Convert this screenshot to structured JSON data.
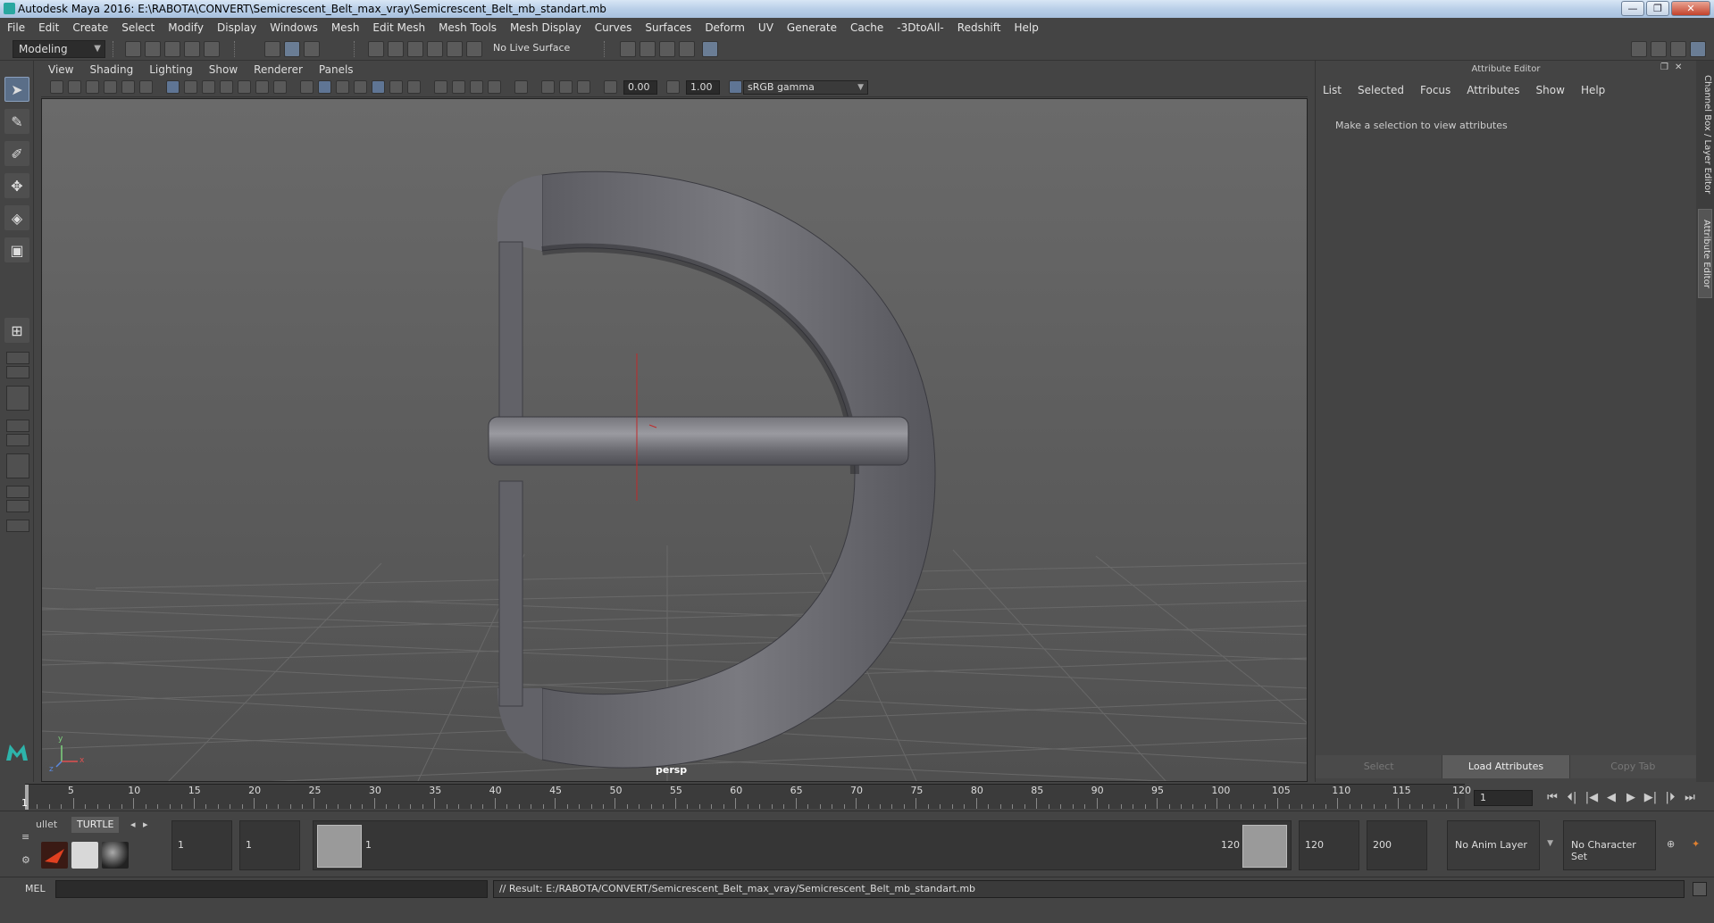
{
  "window": {
    "title": "Autodesk Maya 2016: E:\\RABOTA\\CONVERT\\Semicrescent_Belt_max_vray\\Semicrescent_Belt_mb_standart.mb",
    "buttons": {
      "minimize": "—",
      "maximize": "❐",
      "close": "✕"
    }
  },
  "menubar": [
    "File",
    "Edit",
    "Create",
    "Select",
    "Modify",
    "Display",
    "Windows",
    "Mesh",
    "Edit Mesh",
    "Mesh Tools",
    "Mesh Display",
    "Curves",
    "Surfaces",
    "Deform",
    "UV",
    "Generate",
    "Cache",
    "-3DtoAll-",
    "Redshift",
    "Help"
  ],
  "statusline": {
    "mode": "Modeling",
    "live_surface": "No Live Surface"
  },
  "viewport": {
    "menus": [
      "View",
      "Shading",
      "Lighting",
      "Show",
      "Renderer",
      "Panels"
    ],
    "exposure": "0.00",
    "gamma": "1.00",
    "color_space": "sRGB gamma",
    "camera_label": "persp",
    "axis_x": "x",
    "axis_y": "y",
    "axis_z": "z"
  },
  "attribute_editor": {
    "title": "Attribute Editor",
    "menus": [
      "List",
      "Selected",
      "Focus",
      "Attributes",
      "Show",
      "Help"
    ],
    "message": "Make a selection to view attributes",
    "buttons": [
      "Select",
      "Load Attributes",
      "Copy Tab"
    ]
  },
  "side_tabs": [
    "Channel Box / Layer Editor",
    "Attribute Editor"
  ],
  "timeslider": {
    "ticks": [
      1,
      5,
      10,
      15,
      20,
      25,
      30,
      35,
      40,
      45,
      50,
      55,
      60,
      65,
      70,
      75,
      80,
      85,
      90,
      95,
      100,
      105,
      110,
      115,
      120
    ],
    "current_frame": "1",
    "frame_field": "1",
    "start": 1,
    "end": 120
  },
  "playback": [
    "⏮",
    "⏴|",
    "|◀",
    "◀",
    "▶",
    "▶|",
    "|⏵",
    "⏭"
  ],
  "range": {
    "shelf_tabs": [
      "ullet",
      "TURTLE"
    ],
    "start_field": "1",
    "range_start_field": "1",
    "range_handle_start": "1",
    "range_handle_end": "120",
    "range_end_field": "120",
    "end_field": "200",
    "anim_layer": "No Anim Layer",
    "character_set": "No Character Set"
  },
  "cmdline": {
    "label": "MEL",
    "result": "// Result: E:/RABOTA/CONVERT/Semicrescent_Belt_max_vray/Semicrescent_Belt_mb_standart.mb"
  },
  "colors": {
    "accent": "#5a6e88",
    "viewport_top": "#6a6a6a",
    "viewport_bottom": "#505050",
    "model": "#6b6b70"
  }
}
